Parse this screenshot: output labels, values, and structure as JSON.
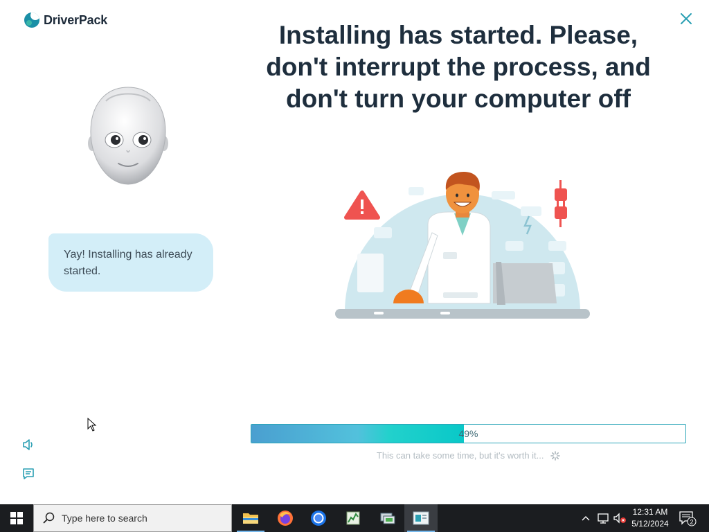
{
  "app": {
    "logo_text": "DriverPack",
    "headline_lines": [
      "Installing has started. Please,",
      "don't interrupt the process, and",
      "don't turn your computer off"
    ],
    "bubble_text": "Yay! Installing has already started.",
    "progress": {
      "percent_value": 49,
      "label": "49%"
    },
    "hint_text": "This can take some time, but it's worth it...",
    "colors": {
      "accent": "#2aa5b8",
      "headline": "#1e2e3d",
      "bubble_bg": "#d3eef8",
      "illustration_bg": "#cfe8ef",
      "warning_red": "#ef5350"
    },
    "icons": [
      "close-icon",
      "sound-icon",
      "chat-icon",
      "spinner-icon",
      "warning-icon",
      "plug-icon"
    ]
  },
  "taskbar": {
    "search_placeholder": "Type here to search",
    "apps": [
      "file-explorer",
      "firefox",
      "chrome",
      "task-manager",
      "network-app",
      "driverpack-app"
    ],
    "active_app": "driverpack-app",
    "clock_time": "12:31 AM",
    "clock_date": "5/12/2024",
    "notification_count": "2"
  }
}
